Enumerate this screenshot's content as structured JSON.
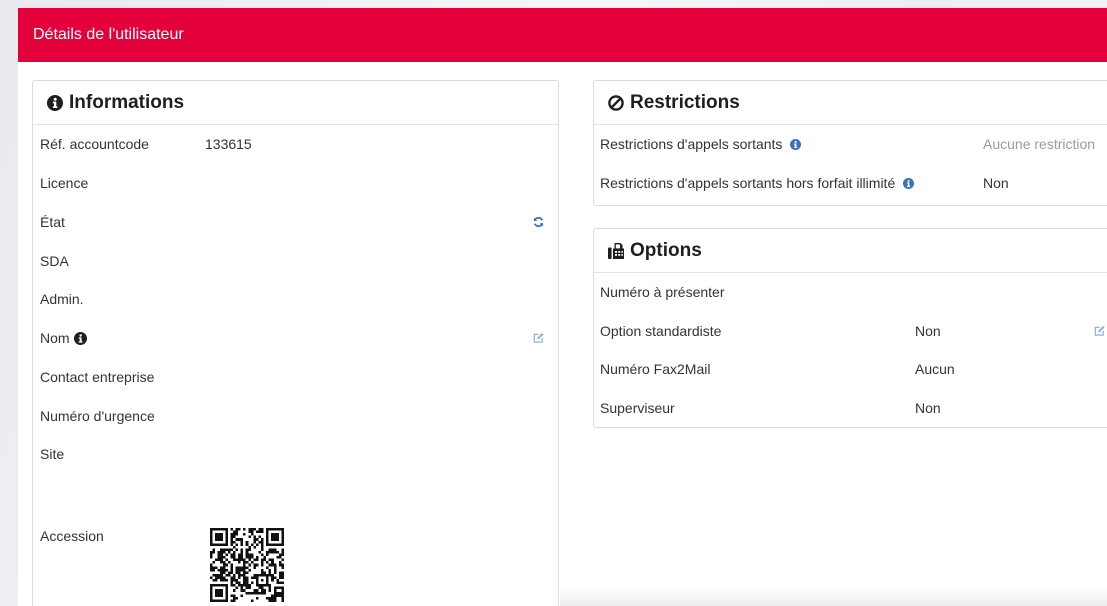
{
  "page": {
    "title": "Détails de l'utilisateur"
  },
  "colors": {
    "brand_red": "#e3003b",
    "text": "#333333",
    "muted": "#9a9a9a",
    "info_blue": "#3a72b8",
    "edit_blue": "#8ab3db",
    "refresh_blue": "#2c6fb4"
  },
  "informations": {
    "title": "Informations",
    "icon": "info-circle-icon",
    "rows": {
      "accountcode": {
        "label": "Réf. accountcode",
        "value": "133615"
      },
      "licence": {
        "label": "Licence"
      },
      "etat": {
        "label": "État",
        "action_icon": "refresh-icon"
      },
      "sda": {
        "label": "SDA"
      },
      "admin": {
        "label": "Admin."
      },
      "nom": {
        "label": "Nom",
        "help_icon": "info-circle-icon",
        "action_icon": "edit-icon"
      },
      "contact": {
        "label": "Contact entreprise"
      },
      "urgence": {
        "label": "Numéro d'urgence"
      },
      "site": {
        "label": "Site"
      },
      "accession": {
        "label": "Accession",
        "image_icon": "qr-code-icon"
      }
    }
  },
  "restrictions": {
    "title": "Restrictions",
    "icon": "ban-icon",
    "rows": [
      {
        "label": "Restrictions d'appels sortants",
        "help_icon": "info-circle-icon",
        "value": "Aucune restriction"
      },
      {
        "label": "Restrictions d'appels sortants hors forfait illimité",
        "help_icon": "info-circle-icon",
        "value": "Non"
      }
    ]
  },
  "options": {
    "title": "Options",
    "icon": "fax-icon",
    "rows": [
      {
        "label": "Numéro à présenter"
      },
      {
        "label": "Option standardiste",
        "value": "Non",
        "action_icon": "edit-icon"
      },
      {
        "label": "Numéro Fax2Mail",
        "value": "Aucun"
      },
      {
        "label": "Superviseur",
        "value": "Non"
      }
    ]
  }
}
